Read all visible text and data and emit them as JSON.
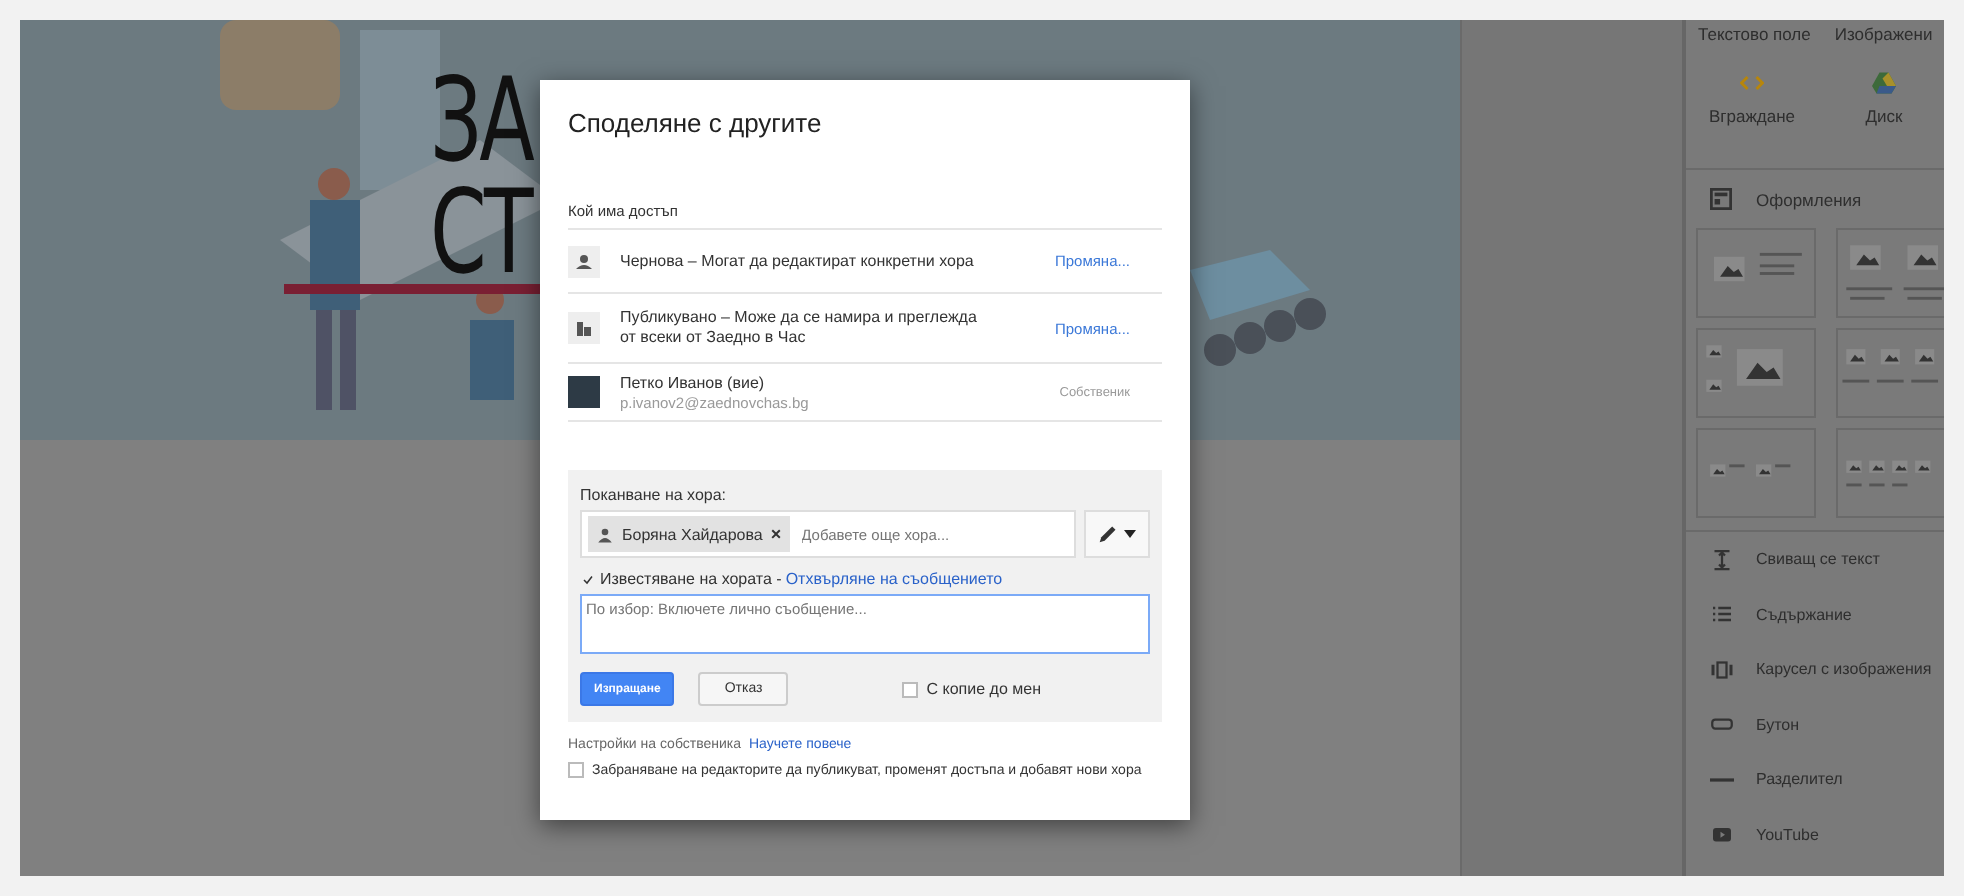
{
  "banner": {
    "title_lines": [
      "ЗА",
      "СТ"
    ]
  },
  "sidebar": {
    "top_items": [
      {
        "label": "Текстово поле"
      },
      {
        "label": "Изображени"
      }
    ],
    "inserts": [
      {
        "label": "Вграждане",
        "kind": "embed"
      },
      {
        "label": "Диск",
        "kind": "drive"
      }
    ],
    "layouts_heading": "Оформления",
    "items": [
      {
        "label": "Свиващ се текст",
        "kind": "collapse"
      },
      {
        "label": "Съдържание",
        "kind": "toc"
      },
      {
        "label": "Карусел с изображения",
        "kind": "carousel"
      },
      {
        "label": "Бутон",
        "kind": "button"
      },
      {
        "label": "Разделител",
        "kind": "divider"
      },
      {
        "label": "YouTube",
        "kind": "youtube"
      }
    ]
  },
  "dialog": {
    "title": "Споделяне с другите",
    "access_heading": "Кой има достъп",
    "access": [
      {
        "kind": "draft",
        "text": "Чернова – Могат да редактират конкретни хора",
        "action": "Промяна..."
      },
      {
        "kind": "published",
        "text": "Публикувано – Може да се намира и преглежда от всеки от Заедно в Час",
        "action": "Промяна..."
      },
      {
        "kind": "owner",
        "name": "Петко Иванов (вие)",
        "email": "p.ivanov2@zaednovchas.bg",
        "role": "Собственик"
      }
    ],
    "invite": {
      "label": "Поканване на хора:",
      "chips": [
        {
          "name": "Боряна Хайдарова",
          "remove": "×"
        }
      ],
      "placeholder": "Добавете още хора...",
      "notify": {
        "checked": true,
        "label": "Известяване на хората -",
        "link": "Отхвърляне на съобщението"
      },
      "message_placeholder": "По избор: Включете лично съобщение...",
      "send": "Изпращане",
      "cancel": "Отказ",
      "copy": {
        "checked": false,
        "label": "С копие до мен"
      }
    },
    "owner_settings": {
      "label": "Настройки на собственика",
      "link": "Научете повече"
    },
    "restrict": {
      "checked": false,
      "label": "Забраняване на редакторите да публикуват, променят достъпа и добавят нови хора"
    }
  }
}
